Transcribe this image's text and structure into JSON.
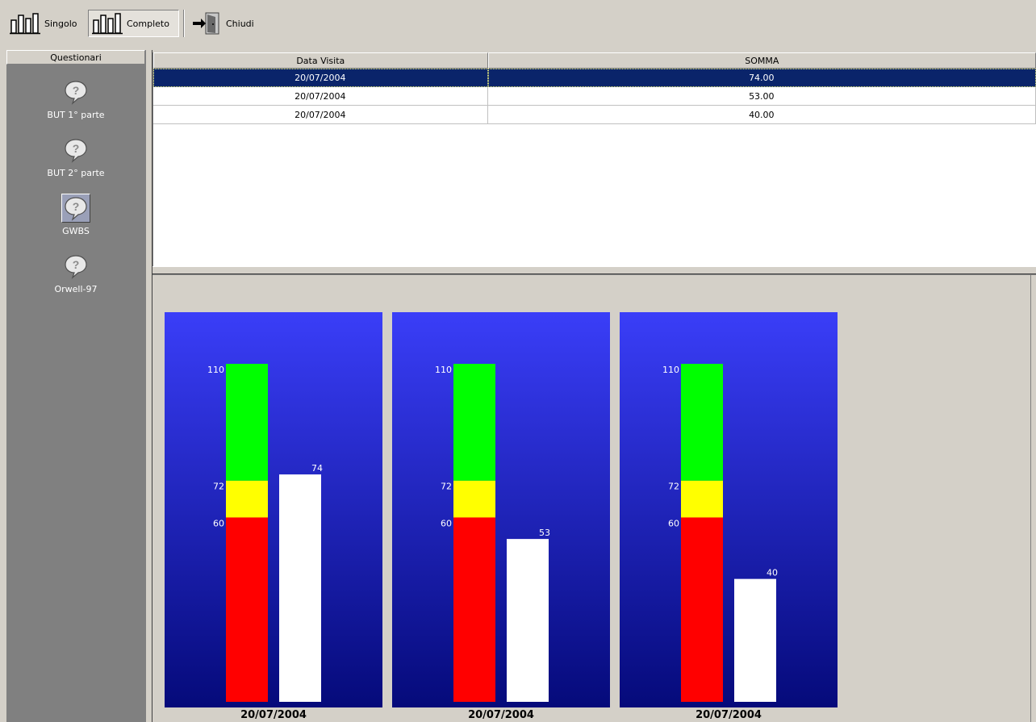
{
  "toolbar": {
    "singolo_label": "Singolo",
    "completo_label": "Completo",
    "chiudi_label": "Chiudi",
    "singolo_icon": "bar-chart-icon",
    "completo_icon": "bar-chart-icon",
    "chiudi_icon": "exit-door-icon"
  },
  "sidebar": {
    "header": "Questionari",
    "items": [
      {
        "label": "BUT 1° parte",
        "icon": "question-balloon-icon",
        "active": false
      },
      {
        "label": "BUT 2° parte",
        "icon": "question-balloon-icon",
        "active": false
      },
      {
        "label": "GWBS",
        "icon": "question-balloon-icon",
        "active": true
      },
      {
        "label": "Orwell-97",
        "icon": "question-balloon-icon",
        "active": false
      }
    ]
  },
  "grid": {
    "columns": [
      "Data Visita",
      "SOMMA"
    ],
    "rows": [
      {
        "data": "20/07/2004",
        "somma": "74.00",
        "selected": true
      },
      {
        "data": "20/07/2004",
        "somma": "53.00",
        "selected": false
      },
      {
        "data": "20/07/2004",
        "somma": "40.00",
        "selected": false
      }
    ]
  },
  "colors": {
    "green": "#00ff00",
    "yellow": "#ffff00",
    "red": "#ff0000",
    "bar": "#ffffff",
    "selection": "#0a246a"
  },
  "chart_data": [
    {
      "type": "bar",
      "x_label": "20/07/2004",
      "value": 74,
      "thresholds": [
        60,
        72,
        110
      ],
      "ylim": [
        0,
        110
      ]
    },
    {
      "type": "bar",
      "x_label": "20/07/2004",
      "value": 53,
      "thresholds": [
        60,
        72,
        110
      ],
      "ylim": [
        0,
        110
      ]
    },
    {
      "type": "bar",
      "x_label": "20/07/2004",
      "value": 40,
      "thresholds": [
        60,
        72,
        110
      ],
      "ylim": [
        0,
        110
      ]
    }
  ]
}
